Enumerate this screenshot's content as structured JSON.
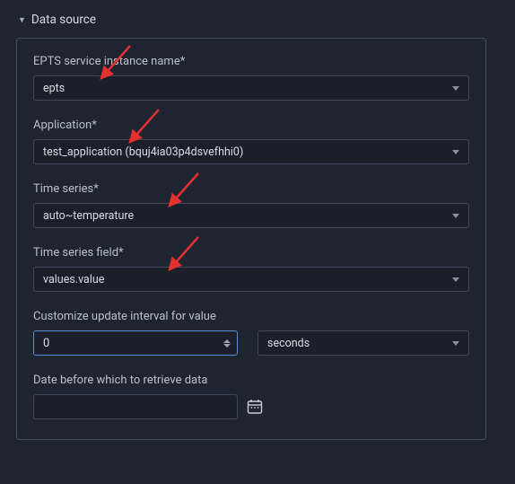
{
  "section": {
    "title": "Data source"
  },
  "fields": {
    "service": {
      "label": "EPTS service instance name*",
      "value": "epts"
    },
    "app": {
      "label": "Application*",
      "value": "test_application (bquj4ia03p4dsvefhhi0)"
    },
    "series": {
      "label": "Time series*",
      "value": "auto~temperature"
    },
    "field": {
      "label": "Time series field*",
      "value": "values.value"
    },
    "interval": {
      "label": "Customize update interval for value",
      "value": "0",
      "unit": "seconds"
    },
    "date": {
      "label": "Date before which to retrieve data",
      "value": ""
    }
  }
}
